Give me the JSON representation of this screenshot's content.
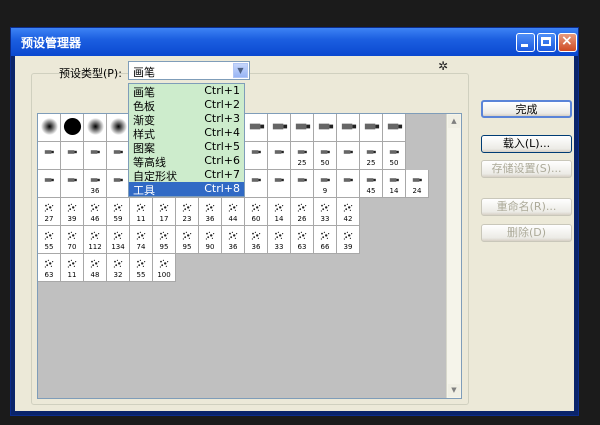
{
  "window": {
    "title": "预设管理器"
  },
  "preset": {
    "label": "预设类型(P):",
    "value": "画笔",
    "options": [
      {
        "label": "画笔",
        "shortcut": "Ctrl+1"
      },
      {
        "label": "色板",
        "shortcut": "Ctrl+2"
      },
      {
        "label": "渐变",
        "shortcut": "Ctrl+3"
      },
      {
        "label": "样式",
        "shortcut": "Ctrl+4"
      },
      {
        "label": "图案",
        "shortcut": "Ctrl+5"
      },
      {
        "label": "等高线",
        "shortcut": "Ctrl+6"
      },
      {
        "label": "自定形状",
        "shortcut": "Ctrl+7"
      },
      {
        "label": "工具",
        "shortcut": "Ctrl+8"
      }
    ],
    "highlighted_index": 7
  },
  "buttons": {
    "done": "完成",
    "load": "载入(L)...",
    "save": "存储设置(S)...",
    "rename": "重命名(R)...",
    "delete": "删除(D)"
  },
  "grid": {
    "rows": [
      [
        "",
        "",
        "",
        "",
        "",
        "",
        "",
        "",
        "",
        "",
        "",
        "",
        "",
        "",
        "",
        ""
      ],
      [
        "",
        "",
        "",
        "",
        "",
        "",
        "",
        "",
        "",
        "",
        "",
        "25",
        "50",
        "",
        "25",
        "50"
      ],
      [
        "",
        "",
        "36",
        "",
        "",
        "",
        "",
        "",
        "",
        "",
        "",
        "",
        "9",
        "",
        "45",
        "14",
        "24"
      ],
      [
        "27",
        "39",
        "46",
        "59",
        "11",
        "17",
        "23",
        "36",
        "44",
        "60",
        "14",
        "26",
        "33",
        "42"
      ],
      [
        "55",
        "70",
        "112",
        "134",
        "74",
        "95",
        "95",
        "90",
        "36",
        "36",
        "33",
        "63",
        "66",
        "39"
      ],
      [
        "63",
        "11",
        "48",
        "32",
        "55",
        "100"
      ]
    ]
  }
}
